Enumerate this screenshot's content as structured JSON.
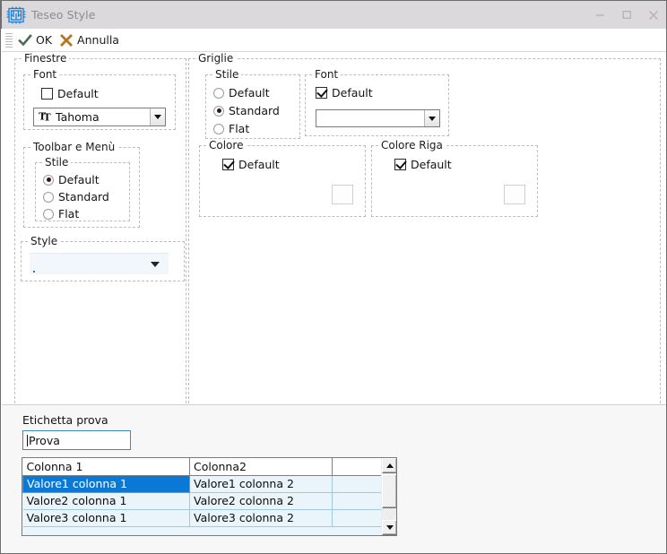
{
  "window": {
    "title": "Teseo Style",
    "icon": "app-maze-icon",
    "minimize_label": "─",
    "maximize_label": "□",
    "close_label": "✕"
  },
  "toolbar": {
    "ok_label": "OK",
    "cancel_label": "Annulla",
    "ok_icon": "check-icon",
    "cancel_icon": "cross-icon"
  },
  "finestre": {
    "title": "Finestre",
    "font": {
      "title": "Font",
      "default_label": "Default",
      "default_checked": false,
      "combo_value": "Tahoma",
      "combo_icon": "truetype-font-icon"
    },
    "toolbar_menu": {
      "title": "Toolbar e Menù",
      "stile": {
        "title": "Stile",
        "options": [
          {
            "label": "Default",
            "selected": true
          },
          {
            "label": "Standard",
            "selected": false
          },
          {
            "label": "Flat",
            "selected": false
          }
        ]
      }
    },
    "style": {
      "title": "Style",
      "combo_value": ""
    }
  },
  "griglie": {
    "title": "Griglie",
    "stile": {
      "title": "Stile",
      "options": [
        {
          "label": "Default",
          "selected": false
        },
        {
          "label": "Standard",
          "selected": true
        },
        {
          "label": "Flat",
          "selected": false
        }
      ]
    },
    "font": {
      "title": "Font",
      "default_label": "Default",
      "default_checked": true,
      "combo_value": ""
    },
    "colore": {
      "title": "Colore",
      "default_label": "Default",
      "default_checked": true,
      "swatch_color": "#fdfdfd"
    },
    "colore_riga": {
      "title": "Colore Riga",
      "default_label": "Default",
      "default_checked": true,
      "swatch_color": "#fdfdfd"
    }
  },
  "preview": {
    "label": "Etichetta prova",
    "textbox_value": "Prova",
    "grid": {
      "columns": [
        "Colonna 1",
        "Colonna2"
      ],
      "rows": [
        {
          "cells": [
            "Valore1 colonna 1",
            "Valore1  colonna 2"
          ],
          "selected": true
        },
        {
          "cells": [
            "Valore2 colonna 1",
            "Valore2 colonna 2"
          ],
          "selected": false
        },
        {
          "cells": [
            "Valore3 colonna 1",
            "Valore3 colonna 2"
          ],
          "selected": false
        }
      ],
      "scrollbar": {
        "up_icon": "scroll-up-arrow-icon",
        "down_icon": "scroll-down-arrow-icon"
      }
    }
  },
  "colors": {
    "titlebar_bg": "#dcd9dd",
    "selection_blue": "#0a78d4",
    "grid_row_bg": "#eaf4fb",
    "accent_border": "#3a8ac4"
  }
}
